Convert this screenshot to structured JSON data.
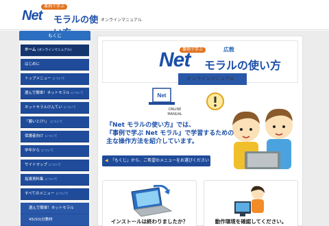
{
  "header": {
    "logo_tag": "事例で学ぶ",
    "logo_net": "Net",
    "logo_rest": "モラルの使い方",
    "subtitle": "オンラインマニュアル"
  },
  "sidebar": {
    "title": "もくじ",
    "items": [
      {
        "label": "ホーム",
        "sub": "(オンラインマニュアル)"
      },
      {
        "label": "はじめに",
        "sub": ""
      },
      {
        "label": "トップメニュー",
        "sub": "について"
      },
      {
        "label": "選んで簡単！ネットモラル",
        "sub": "について"
      },
      {
        "label": "ネットモラルけんてい",
        "sub": "について"
      },
      {
        "label": "「聴いとけ!」",
        "sub": "について"
      },
      {
        "label": "保護者向け",
        "sub": "について"
      },
      {
        "label": "学年から",
        "sub": "について"
      },
      {
        "label": "サイトマップ",
        "sub": "について"
      },
      {
        "label": "指導資料集",
        "sub": "について"
      },
      {
        "label": "すべてのメニュー",
        "sub": "について"
      }
    ],
    "subitems": [
      {
        "label": "選んで簡単！ネットモラル"
      },
      {
        "label": "45(50)分教材"
      }
    ]
  },
  "banner": {
    "tag": "事例で学ぶ",
    "net": "Net",
    "rest": "モラルの使い方",
    "publisher": "広教",
    "subtitle": "オンラインマニュアル"
  },
  "manual_icon": {
    "line1": "ONLINE",
    "line2": "MANUAL"
  },
  "intro": {
    "line1": "『Net モラルの使い方』では、",
    "line2": "『事例で学ぶ Net モラル』で学習するための",
    "line3": "主な操作方法を紹介しています。"
  },
  "cta": {
    "label": "「もくじ」から、ご希望のメニューをお選びください"
  },
  "boxes": [
    {
      "caption": "インストールは終わりましたか？",
      "icon": "laptop-icon"
    },
    {
      "caption": "動作環境を確認してください。",
      "icon": "teacher-pc-icon"
    }
  ],
  "colors": {
    "nav_blue": "#1f4b9a",
    "logo_blue": "#1b4fa8",
    "accent_orange": "#e2731f"
  }
}
